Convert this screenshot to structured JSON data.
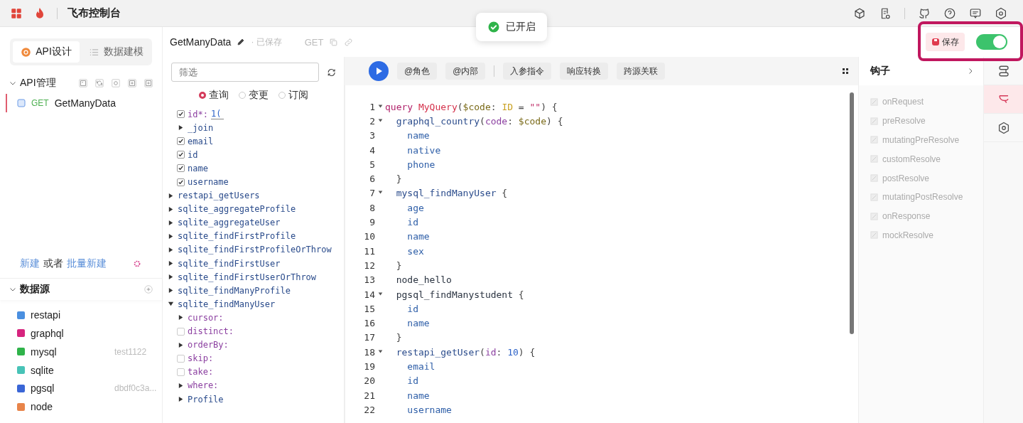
{
  "topbar": {
    "title": "飞布控制台"
  },
  "toast": {
    "text": "已开启"
  },
  "header": {
    "api_name": "GetManyData",
    "saved": "· 已保存",
    "method": "GET",
    "save_button": "保存",
    "toggle": {
      "on": true
    }
  },
  "sidebar": {
    "tabs": [
      {
        "label": "API设计",
        "selected": true
      },
      {
        "label": "数据建模",
        "selected": false
      }
    ],
    "api_section": {
      "title": "API管理",
      "expanded": true,
      "items": [
        {
          "method": "GET",
          "name": "GetManyData",
          "selected": true
        }
      ]
    },
    "create": {
      "new": "新建",
      "or": "或者",
      "batch": "批量新建"
    },
    "datasource_section": {
      "title": "数据源",
      "expanded": true,
      "items": [
        {
          "name": "restapi",
          "color": "#4a8fe0"
        },
        {
          "name": "graphql",
          "color": "#d6247e"
        },
        {
          "name": "mysql",
          "color": "#2fb34a",
          "note": "test1122"
        },
        {
          "name": "sqlite",
          "color": "#48c3b7"
        },
        {
          "name": "pgsql",
          "color": "#3a66d6",
          "note": "dbdf0c3a..."
        },
        {
          "name": "node",
          "color": "#e8844a"
        }
      ]
    }
  },
  "explorer": {
    "filter_placeholder": "筛选",
    "operation_types": [
      {
        "label": "查询",
        "selected": true
      },
      {
        "label": "变更",
        "selected": false
      },
      {
        "label": "订阅",
        "selected": false
      }
    ],
    "fields": [
      {
        "label": "id*:",
        "kind": "arg-checkbox",
        "checked": true,
        "value": "1("
      },
      {
        "label": "_join",
        "kind": "field-expandable",
        "expanded": false
      },
      {
        "label": "email",
        "kind": "field-checkbox",
        "checked": true
      },
      {
        "label": "id",
        "kind": "field-checkbox",
        "checked": true
      },
      {
        "label": "name",
        "kind": "field-checkbox",
        "checked": true
      },
      {
        "label": "username",
        "kind": "field-checkbox",
        "checked": true
      }
    ],
    "operations": [
      {
        "label": "restapi_getUsers",
        "expanded": false
      },
      {
        "label": "sqlite_aggregateProfile",
        "expanded": false
      },
      {
        "label": "sqlite_aggregateUser",
        "expanded": false
      },
      {
        "label": "sqlite_findFirstProfile",
        "expanded": false
      },
      {
        "label": "sqlite_findFirstProfileOrThrow",
        "expanded": false
      },
      {
        "label": "sqlite_findFirstUser",
        "expanded": false
      },
      {
        "label": "sqlite_findFirstUserOrThrow",
        "expanded": false
      },
      {
        "label": "sqlite_findManyProfile",
        "expanded": false
      },
      {
        "label": "sqlite_findManyUser",
        "expanded": true,
        "children": [
          {
            "label": "cursor:",
            "kind": "arg-expandable",
            "expanded": false
          },
          {
            "label": "distinct:",
            "kind": "arg-checkbox",
            "checked": false
          },
          {
            "label": "orderBy:",
            "kind": "arg-expandable",
            "expanded": false
          },
          {
            "label": "skip:",
            "kind": "arg-checkbox",
            "checked": false
          },
          {
            "label": "take:",
            "kind": "arg-checkbox",
            "checked": false
          },
          {
            "label": "where:",
            "kind": "arg-expandable",
            "expanded": false
          },
          {
            "label": "Profile",
            "kind": "field-expandable",
            "expanded": false
          }
        ]
      }
    ]
  },
  "editor": {
    "toolbar": [
      "@角色",
      "@内部",
      "入参指令",
      "响应转换",
      "跨源关联"
    ],
    "lines": [
      {
        "num": "1",
        "fold": true,
        "tokens": [
          {
            "text": "query",
            "kind": "keyword"
          },
          {
            "text": " MyQuery",
            "kind": "def"
          },
          {
            "text": "(",
            "kind": "punct"
          },
          {
            "text": "$code",
            "kind": "variable"
          },
          {
            "text": ": ",
            "kind": "punct"
          },
          {
            "text": "ID",
            "kind": "type"
          },
          {
            "text": " = ",
            "kind": "punct"
          },
          {
            "text": "\"\"",
            "kind": "string"
          },
          {
            "text": ") {",
            "kind": "punct"
          }
        ]
      },
      {
        "num": "2",
        "fold": true,
        "tokens": [
          {
            "text": "  graphql_country",
            "kind": "root"
          },
          {
            "text": "(",
            "kind": "punct"
          },
          {
            "text": "code",
            "kind": "arg"
          },
          {
            "text": ": ",
            "kind": "punct"
          },
          {
            "text": "$code",
            "kind": "variable"
          },
          {
            "text": ") {",
            "kind": "punct"
          }
        ]
      },
      {
        "num": "3",
        "fold": false,
        "tokens": [
          {
            "text": "    name",
            "kind": "field"
          }
        ]
      },
      {
        "num": "4",
        "fold": false,
        "tokens": [
          {
            "text": "    native",
            "kind": "field"
          }
        ]
      },
      {
        "num": "5",
        "fold": false,
        "tokens": [
          {
            "text": "    phone",
            "kind": "field"
          }
        ]
      },
      {
        "num": "6",
        "fold": false,
        "tokens": [
          {
            "text": "  }",
            "kind": "punct"
          }
        ]
      },
      {
        "num": "7",
        "fold": true,
        "tokens": [
          {
            "text": "  mysql_findManyUser",
            "kind": "root"
          },
          {
            "text": " {",
            "kind": "punct"
          }
        ]
      },
      {
        "num": "8",
        "fold": false,
        "tokens": [
          {
            "text": "    age",
            "kind": "field"
          }
        ]
      },
      {
        "num": "9",
        "fold": false,
        "tokens": [
          {
            "text": "    id",
            "kind": "field"
          }
        ]
      },
      {
        "num": "10",
        "fold": false,
        "tokens": [
          {
            "text": "    name",
            "kind": "field"
          }
        ]
      },
      {
        "num": "11",
        "fold": false,
        "tokens": [
          {
            "text": "    sex",
            "kind": "field"
          }
        ]
      },
      {
        "num": "12",
        "fold": false,
        "tokens": [
          {
            "text": "  }",
            "kind": "punct"
          }
        ]
      },
      {
        "num": "13",
        "fold": false,
        "tokens": [
          {
            "text": "  node_hello",
            "kind": "plain"
          }
        ]
      },
      {
        "num": "14",
        "fold": true,
        "tokens": [
          {
            "text": "  pgsql_findManystudent",
            "kind": "plain"
          },
          {
            "text": " {",
            "kind": "punct"
          }
        ]
      },
      {
        "num": "15",
        "fold": false,
        "tokens": [
          {
            "text": "    id",
            "kind": "field"
          }
        ]
      },
      {
        "num": "16",
        "fold": false,
        "tokens": [
          {
            "text": "    name",
            "kind": "field"
          }
        ]
      },
      {
        "num": "17",
        "fold": false,
        "tokens": [
          {
            "text": "  }",
            "kind": "punct"
          }
        ]
      },
      {
        "num": "18",
        "fold": true,
        "tokens": [
          {
            "text": "  restapi_getUser",
            "kind": "root"
          },
          {
            "text": "(",
            "kind": "punct"
          },
          {
            "text": "id",
            "kind": "arg"
          },
          {
            "text": ": ",
            "kind": "punct"
          },
          {
            "text": "10",
            "kind": "number"
          },
          {
            "text": ") {",
            "kind": "punct"
          }
        ]
      },
      {
        "num": "19",
        "fold": false,
        "tokens": [
          {
            "text": "    email",
            "kind": "field"
          }
        ]
      },
      {
        "num": "20",
        "fold": false,
        "tokens": [
          {
            "text": "    id",
            "kind": "field"
          }
        ]
      },
      {
        "num": "21",
        "fold": false,
        "tokens": [
          {
            "text": "    name",
            "kind": "field"
          }
        ]
      },
      {
        "num": "22",
        "fold": false,
        "tokens": [
          {
            "text": "    username",
            "kind": "field"
          }
        ]
      }
    ]
  },
  "hooks": {
    "title": "钩子",
    "items": [
      {
        "name": "onRequest",
        "disabled": true
      },
      {
        "name": "preResolve",
        "disabled": true
      },
      {
        "name": "mutatingPreResolve",
        "disabled": true
      },
      {
        "name": "customResolve",
        "disabled": true
      },
      {
        "name": "postResolve",
        "disabled": true
      },
      {
        "name": "mutatingPostResolve",
        "disabled": true
      },
      {
        "name": "onResponse",
        "disabled": true
      },
      {
        "name": "mockResolve",
        "disabled": true
      }
    ]
  },
  "side_tools": [
    {
      "selected": false
    },
    {
      "selected": true
    },
    {
      "selected": false
    }
  ]
}
